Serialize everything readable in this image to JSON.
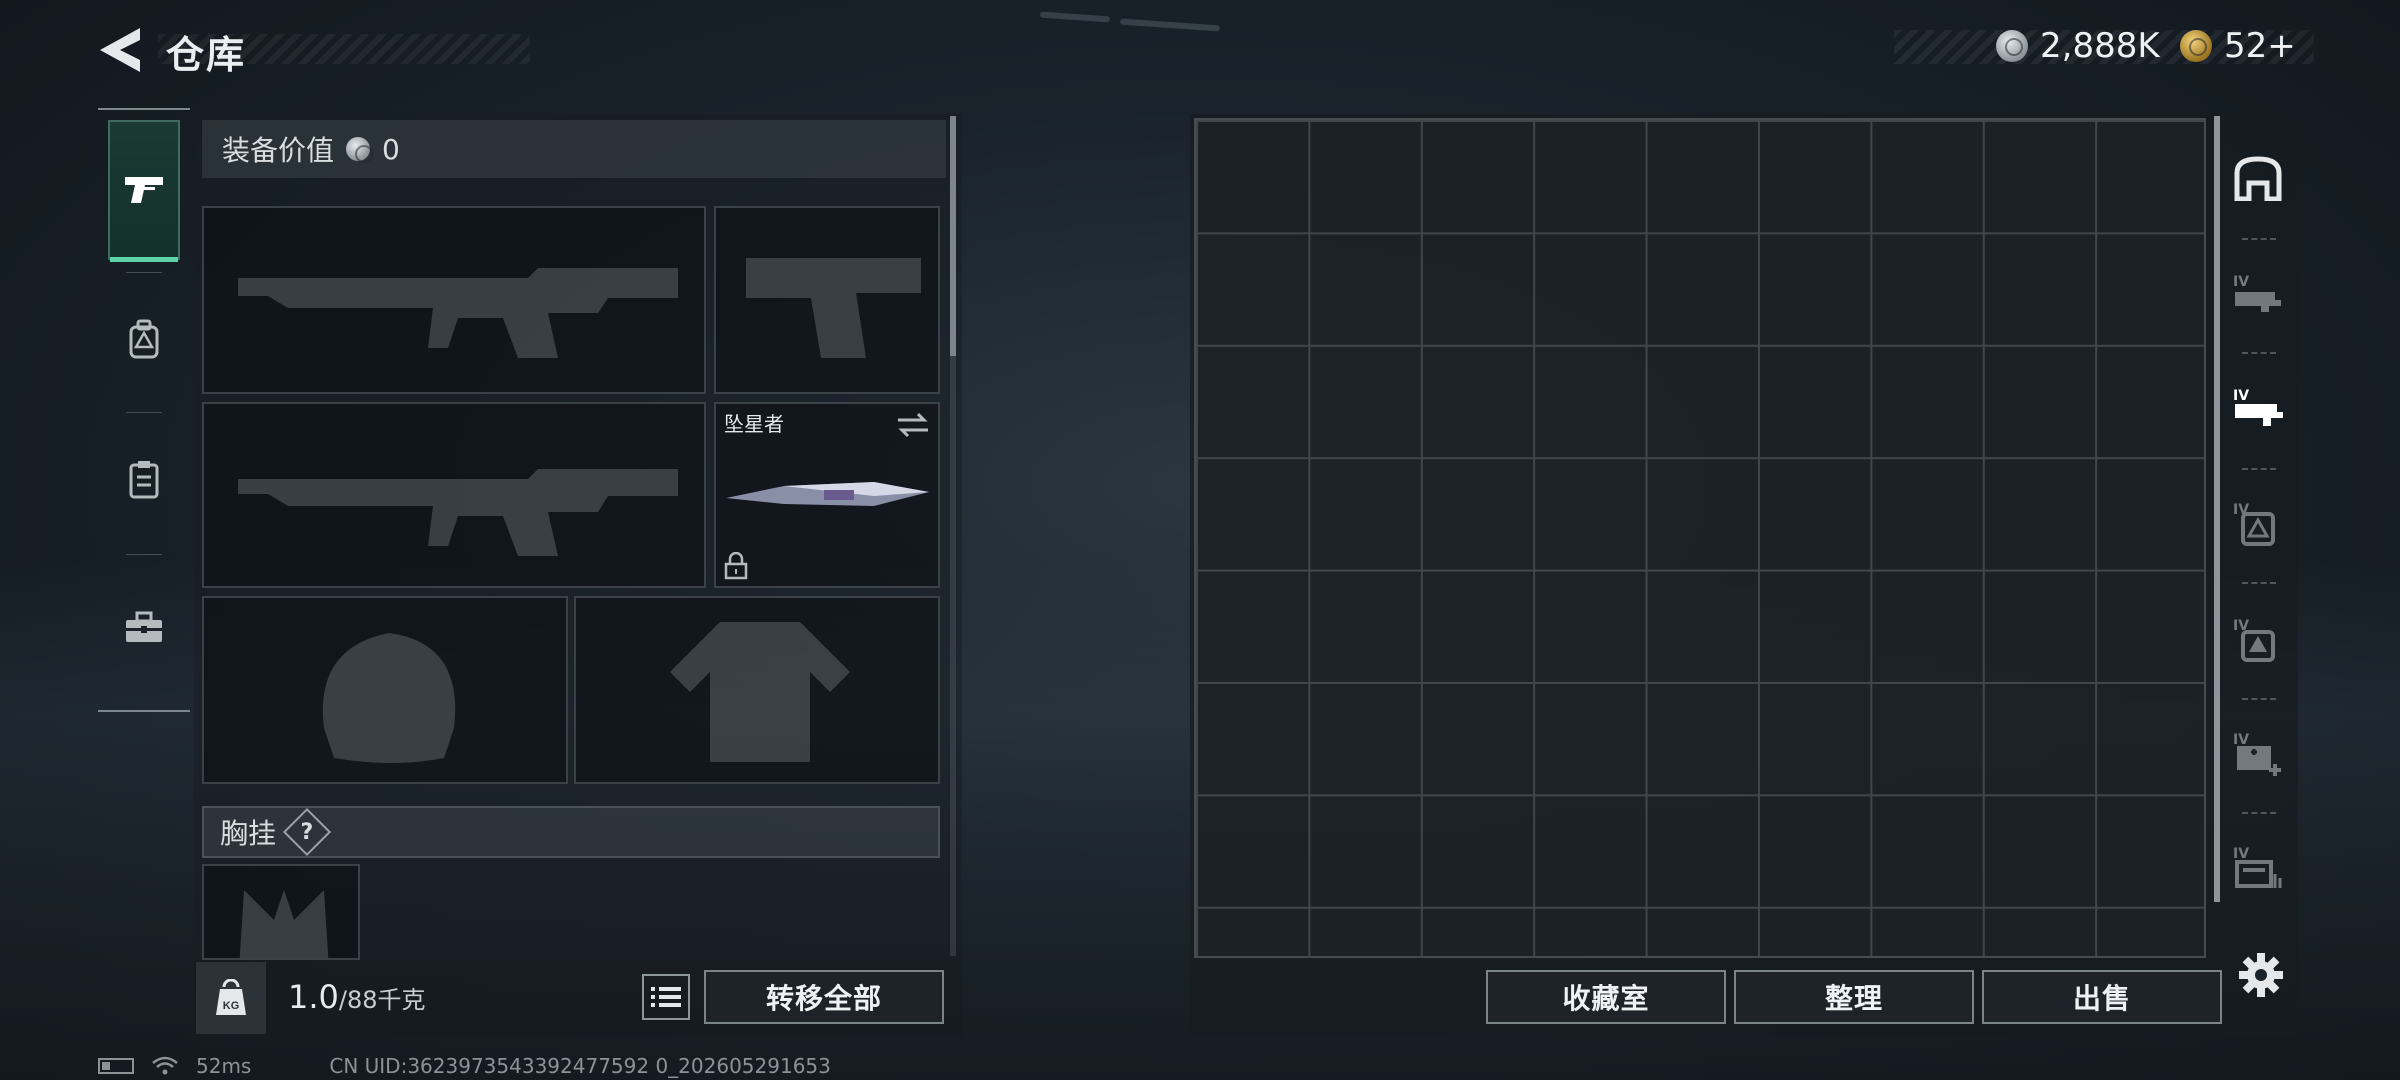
{
  "header": {
    "title": "仓库",
    "currency_silver": "2,888K",
    "currency_gold": "52+"
  },
  "left_tabs": [
    "weapon-tab",
    "backpack-tab",
    "armor-tab",
    "toolbox-tab"
  ],
  "equipment": {
    "value_label": "装备价值",
    "value": "0",
    "melee_label": "坠星者",
    "chest_rig_label": "胸挂",
    "chest_rig_help": "?"
  },
  "footer_left": {
    "weight": "1.0",
    "capacity": "/88千克",
    "kg_icon_text": "KG",
    "transfer_all": "转移全部"
  },
  "footer_right": {
    "collection_room": "收藏室",
    "sort": "整理",
    "sell": "出售"
  },
  "status_bar": {
    "ping": "52ms",
    "uid": "CN UID:3623973543392477592 0_202605291653"
  },
  "colors": {
    "accent_green": "#5fd3a8",
    "panel_bg": "#161c22"
  }
}
